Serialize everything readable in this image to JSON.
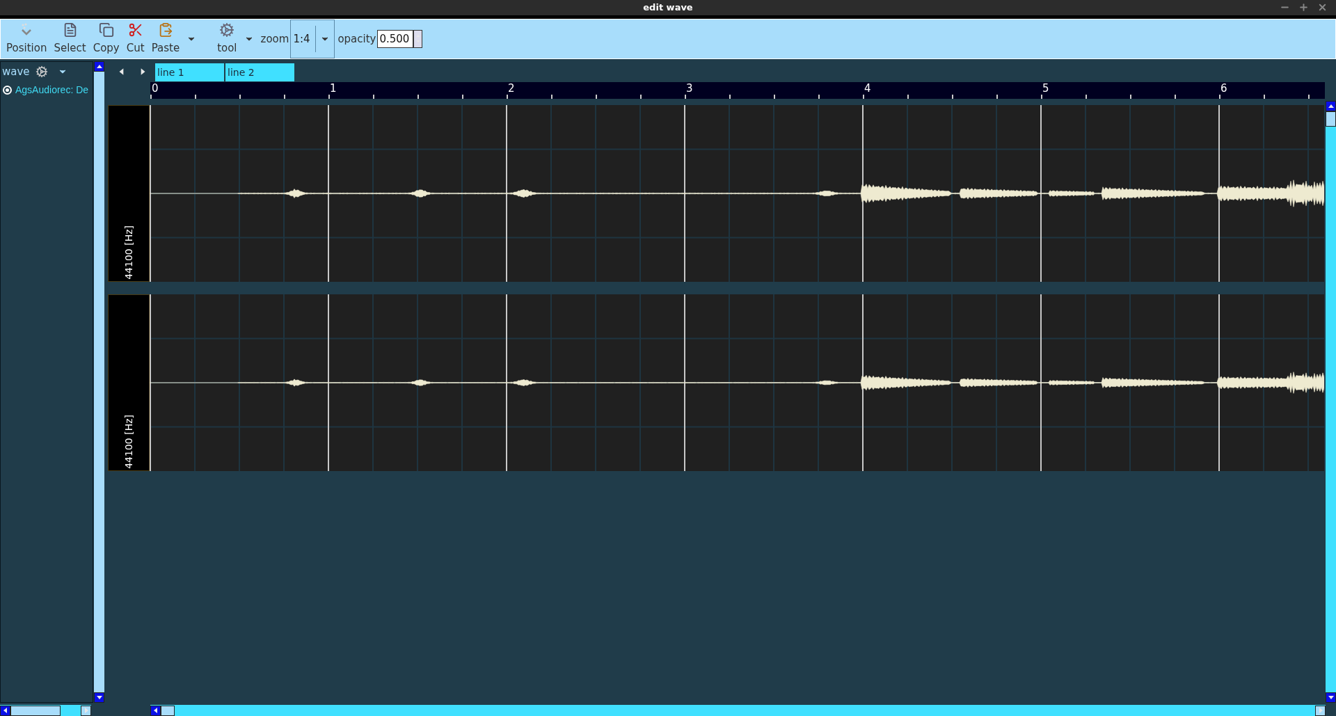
{
  "window": {
    "title": "edit wave"
  },
  "toolbar": {
    "buttons": [
      {
        "kind": "position",
        "label": "Position"
      },
      {
        "kind": "select",
        "label": "Select"
      },
      {
        "kind": "copy",
        "label": "Copy"
      },
      {
        "kind": "cut",
        "label": "Cut"
      },
      {
        "kind": "paste",
        "label": "Paste",
        "menu": true
      },
      {
        "kind": "tool",
        "label": "tool",
        "menu": true
      }
    ],
    "zoom": {
      "label": "zoom",
      "value": "1:4"
    },
    "opacity": {
      "label": "opacity",
      "value": "0.500"
    }
  },
  "sidebar": {
    "title": "wave",
    "items": [
      {
        "label": "AgsAudiorec: De",
        "selected": true
      }
    ]
  },
  "tabs": [
    {
      "label": "line 1"
    },
    {
      "label": "line 2"
    }
  ],
  "ruler": {
    "labels": [
      "0",
      "1",
      "2",
      "3",
      "4",
      "5",
      "6"
    ]
  },
  "tracks": [
    {
      "label": "44100 [Hz]"
    },
    {
      "label": "44100 [Hz]"
    }
  ]
}
